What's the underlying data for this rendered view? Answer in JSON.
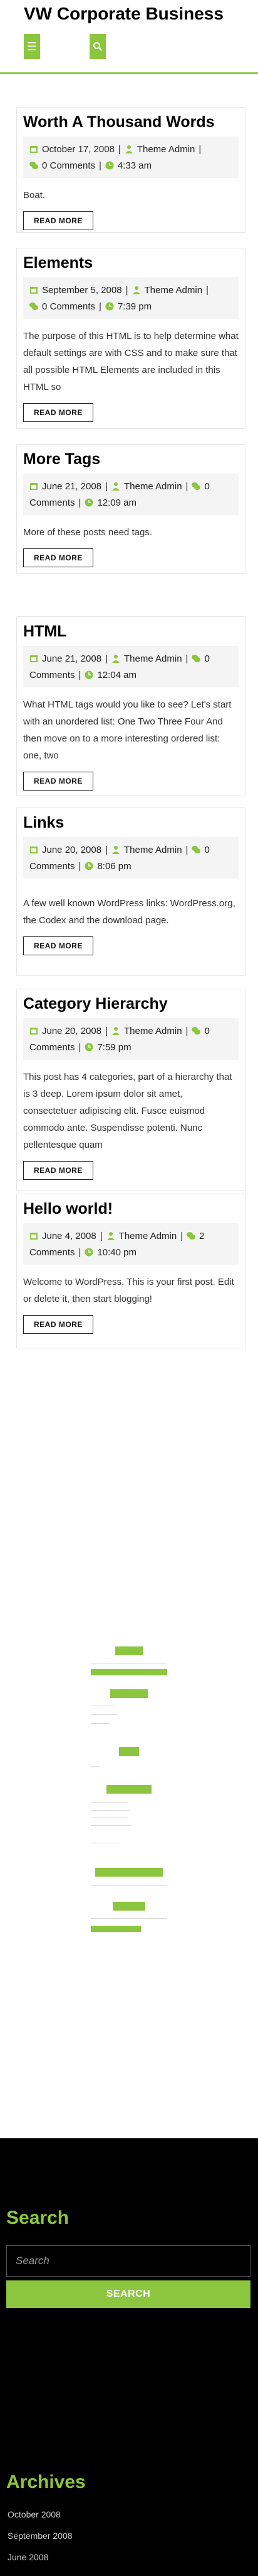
{
  "site": {
    "title": "VW Corporate Business"
  },
  "posts": [
    {
      "title": "Worth A Thousand Words",
      "date": "October 17, 2008",
      "author": "Theme Admin",
      "comments": "0 Comments",
      "time": "4:33 am",
      "excerpt": "Boat.",
      "read_more": "READ MORE"
    },
    {
      "title": "Elements",
      "date": "September 5, 2008",
      "author": "Theme Admin",
      "comments": "0 Comments",
      "time": "7:39 pm",
      "excerpt": "The purpose of this HTML is to help determine what default settings are with CSS and to make sure that all possible HTML Elements are included in this HTML so",
      "read_more": "READ MORE"
    },
    {
      "title": "More Tags",
      "date": "June 21, 2008",
      "author": "Theme Admin",
      "comments": "0 Comments",
      "time": "12:09 am",
      "excerpt": "More of these posts need tags.",
      "read_more": "READ MORE"
    },
    {
      "title": "HTML",
      "date": "June 21, 2008",
      "author": "Theme Admin",
      "comments": "0 Comments",
      "time": "12:04 am",
      "excerpt": "What HTML tags would you like to see? Let's start with an unordered list: One Two Three Four And then move on to a more interesting ordered list: one, two",
      "read_more": "READ MORE"
    },
    {
      "title": "Links",
      "date": "June 20, 2008",
      "author": "Theme Admin",
      "comments": "0 Comments",
      "time": "8:06 pm",
      "excerpt": "A few well known WordPress links: WordPress.org, the Codex and the download page.",
      "read_more": "READ MORE"
    },
    {
      "title": "Category Hierarchy",
      "date": "June 20, 2008",
      "author": "Theme Admin",
      "comments": "0 Comments",
      "time": "7:59 pm",
      "excerpt": "This post has 4 categories, part of a hierarchy that is 3 deep. Lorem ipsum dolor sit amet, consectetuer adipiscing elit. Fusce euismod commodo ante. Suspendisse potenti. Nunc pellentesque quam",
      "read_more": "READ MORE"
    },
    {
      "title": "Hello world!",
      "date": "June 4, 2008",
      "author": "Theme Admin",
      "comments": "2 Comments",
      "time": "10:40 pm",
      "excerpt": "Welcome to WordPress. This is your first post. Edit or delete it, then start blogging!",
      "read_more": "READ MORE"
    }
  ],
  "footer": {
    "search_title": "Search",
    "search_placeholder": "Search",
    "search_button": "SEARCH",
    "archives_title": "Archives",
    "archives": [
      "October 2008",
      "September 2008",
      "June 2008"
    ]
  },
  "colors": {
    "accent": "#8cc63f",
    "footer_bg": "#000000"
  },
  "icons": [
    "menu-icon",
    "search-icon",
    "calendar-icon",
    "user-icon",
    "comments-icon",
    "clock-icon"
  ]
}
